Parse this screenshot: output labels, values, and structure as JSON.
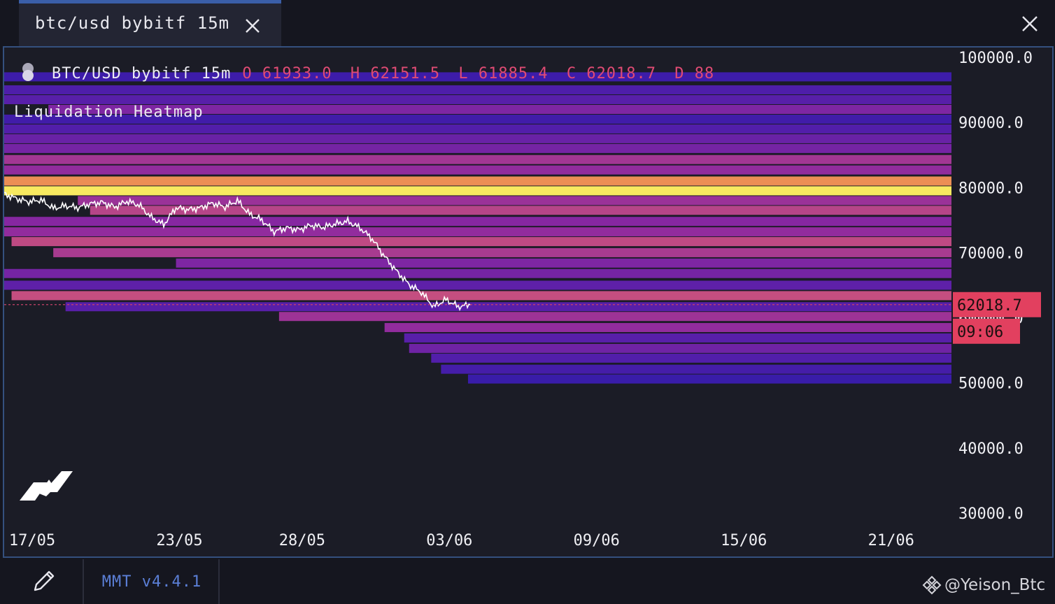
{
  "tab": {
    "label": "btc/usd bybitf 15m"
  },
  "hud": {
    "symbol": "BTC/USD bybitf 15m",
    "open": "O 61933.0",
    "high": "H 62151.5",
    "low": "L 61885.4",
    "close": "C 62018.7",
    "delta": "D 88"
  },
  "indicator": {
    "label": "Liquidation Heatmap"
  },
  "price_tag": {
    "price": "62018.7",
    "countdown": "09:06"
  },
  "footer": {
    "version": "MMT v4.4.1",
    "watermark": "@Yeison_Btc"
  },
  "colors": {
    "accent_border": "#34507e",
    "price_tag": "#e2405f",
    "ohlc_text": "#e04b74",
    "version_text": "#5b7fd6"
  },
  "chart_data": {
    "type": "heatmap",
    "title": "Liquidation Heatmap",
    "y_ticks": [
      "100000.0",
      "90000.0",
      "80000.0",
      "70000.0",
      "62018.7",
      "50000.0",
      "40000.0",
      "30000.0"
    ],
    "y_tick_values": [
      100000,
      90000,
      80000,
      70000,
      60000,
      50000,
      40000,
      30000
    ],
    "x_ticks": [
      "17/05",
      "23/05",
      "28/05",
      "03/06",
      "09/06",
      "15/06",
      "21/06"
    ],
    "x_tick_days": [
      0,
      6,
      11,
      17,
      23,
      29,
      35
    ],
    "ylim": [
      28500,
      101500
    ],
    "xlim_days": [
      0,
      38.6
    ],
    "last_price": 62018.7,
    "price_series": {
      "name": "BTC/USD",
      "days": [
        0,
        0.5,
        1,
        1.5,
        2,
        2.5,
        3,
        3.5,
        4,
        4.5,
        5,
        5.5,
        6,
        6.5,
        7,
        7.5,
        8,
        8.5,
        9,
        9.5,
        10,
        10.5,
        11,
        11.5,
        12,
        12.5,
        13,
        13.5,
        14,
        14.5,
        15,
        15.5,
        16,
        16.5,
        17,
        17.5,
        18,
        18.5,
        19
      ],
      "values": [
        79000,
        78300,
        77800,
        78100,
        76800,
        77200,
        76900,
        77500,
        77700,
        77000,
        77900,
        77300,
        75400,
        74300,
        76900,
        76600,
        76900,
        77600,
        77000,
        78000,
        75900,
        75000,
        73200,
        73800,
        73500,
        74200,
        73900,
        74400,
        74800,
        73800,
        72100,
        69400,
        67100,
        65100,
        63900,
        61700,
        62800,
        61700,
        62000
      ]
    },
    "bands": [
      {
        "price": 97000,
        "from_day": 0,
        "intensity": 0.1
      },
      {
        "price": 95000,
        "from_day": 0,
        "intensity": 0.18
      },
      {
        "price": 93500,
        "from_day": 0,
        "intensity": 0.22
      },
      {
        "price": 92000,
        "from_day": 1.8,
        "intensity": 0.35
      },
      {
        "price": 90500,
        "from_day": 0,
        "intensity": 0.12
      },
      {
        "price": 89000,
        "from_day": 0,
        "intensity": 0.2
      },
      {
        "price": 87500,
        "from_day": 0,
        "intensity": 0.28
      },
      {
        "price": 86000,
        "from_day": 0,
        "intensity": 0.32
      },
      {
        "price": 84300,
        "from_day": 0,
        "intensity": 0.48
      },
      {
        "price": 82700,
        "from_day": 0,
        "intensity": 0.42
      },
      {
        "price": 81000,
        "from_day": 0,
        "intensity": 0.78
      },
      {
        "price": 79500,
        "from_day": 0,
        "intensity": 1.0
      },
      {
        "price": 78000,
        "from_day": 3.0,
        "intensity": 0.45
      },
      {
        "price": 76500,
        "from_day": 3.5,
        "intensity": 0.55
      },
      {
        "price": 74800,
        "from_day": 0,
        "intensity": 0.38
      },
      {
        "price": 73200,
        "from_day": 0,
        "intensity": 0.42
      },
      {
        "price": 71700,
        "from_day": 0.3,
        "intensity": 0.58
      },
      {
        "price": 70000,
        "from_day": 2,
        "intensity": 0.5
      },
      {
        "price": 68400,
        "from_day": 7,
        "intensity": 0.35
      },
      {
        "price": 66800,
        "from_day": 0,
        "intensity": 0.32
      },
      {
        "price": 65000,
        "from_day": 0,
        "intensity": 0.24
      },
      {
        "price": 63400,
        "from_day": 0.3,
        "intensity": 0.6
      },
      {
        "price": 61700,
        "from_day": 2.5,
        "intensity": 0.22
      },
      {
        "price": 60200,
        "from_day": 11.2,
        "intensity": 0.46
      },
      {
        "price": 58500,
        "from_day": 15.5,
        "intensity": 0.42
      },
      {
        "price": 56900,
        "from_day": 16.3,
        "intensity": 0.22
      },
      {
        "price": 55300,
        "from_day": 16.5,
        "intensity": 0.3
      },
      {
        "price": 53800,
        "from_day": 17.4,
        "intensity": 0.2
      },
      {
        "price": 52100,
        "from_day": 17.8,
        "intensity": 0.14
      },
      {
        "price": 50600,
        "from_day": 18.9,
        "intensity": 0.08
      }
    ]
  }
}
